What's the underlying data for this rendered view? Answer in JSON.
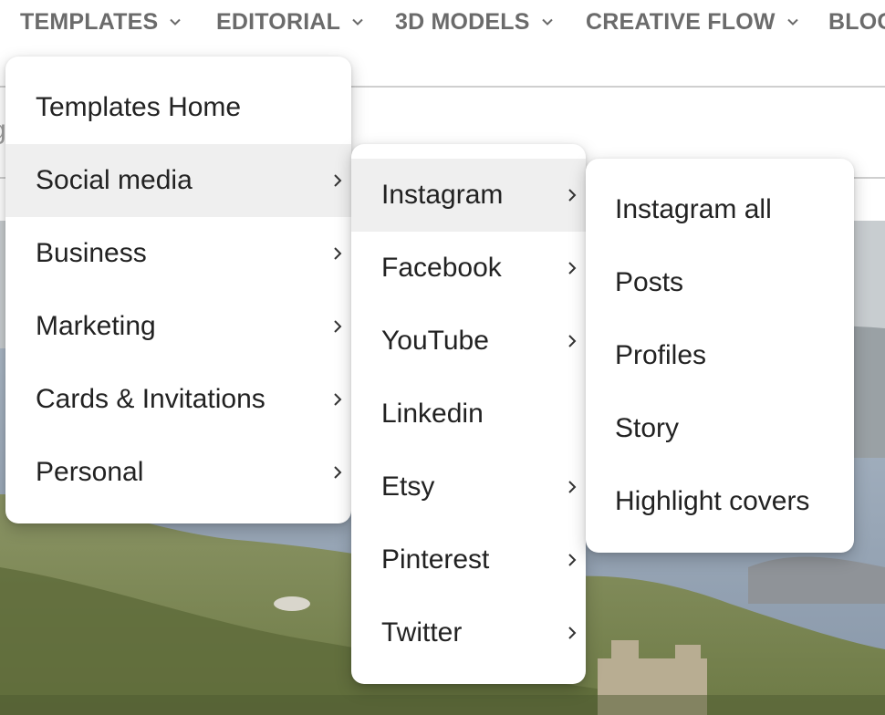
{
  "nav": {
    "items": [
      {
        "label": "TEMPLATES"
      },
      {
        "label": "EDITORIAL"
      },
      {
        "label": "3D MODELS"
      },
      {
        "label": "CREATIVE FLOW"
      },
      {
        "label": "BLOG"
      }
    ],
    "chevron_icon": "chevron-down-icon"
  },
  "search": {
    "placeholder_fragment": "g                                       on"
  },
  "menus": {
    "level1": {
      "items": [
        {
          "label": "Templates Home",
          "has_submenu": false
        },
        {
          "label": "Social media",
          "has_submenu": true,
          "active": true
        },
        {
          "label": "Business",
          "has_submenu": true
        },
        {
          "label": "Marketing",
          "has_submenu": true
        },
        {
          "label": "Cards & Invitations",
          "has_submenu": true
        },
        {
          "label": "Personal",
          "has_submenu": true
        }
      ]
    },
    "level2": {
      "items": [
        {
          "label": "Instagram",
          "has_submenu": true,
          "active": true
        },
        {
          "label": "Facebook",
          "has_submenu": true
        },
        {
          "label": "YouTube",
          "has_submenu": true
        },
        {
          "label": "Linkedin",
          "has_submenu": false
        },
        {
          "label": "Etsy",
          "has_submenu": true
        },
        {
          "label": "Pinterest",
          "has_submenu": true
        },
        {
          "label": "Twitter",
          "has_submenu": true
        }
      ]
    },
    "level3": {
      "items": [
        {
          "label": "Instagram all"
        },
        {
          "label": "Posts"
        },
        {
          "label": "Profiles"
        },
        {
          "label": "Story"
        },
        {
          "label": "Highlight covers"
        }
      ]
    }
  },
  "colors": {
    "nav_text": "#6b6b6b",
    "menu_active_bg": "#efefef",
    "divider": "#cfcfcf"
  }
}
